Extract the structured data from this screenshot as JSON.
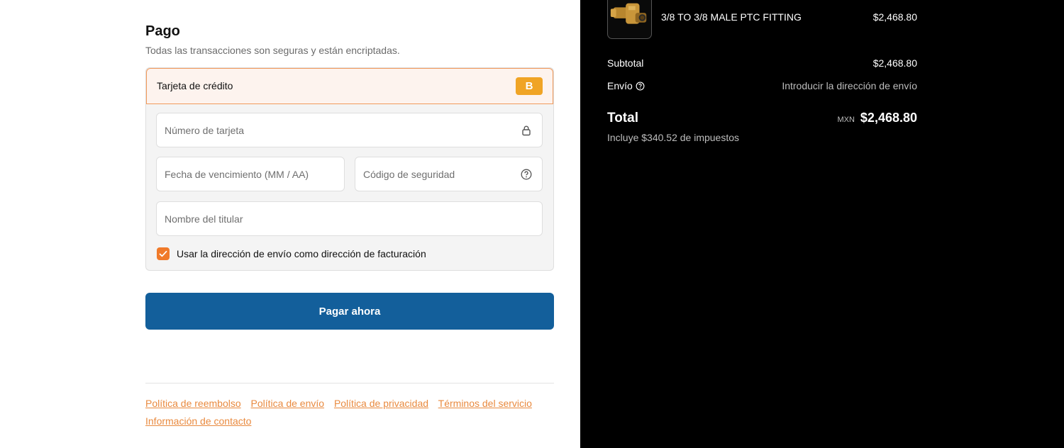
{
  "payment": {
    "title": "Pago",
    "subtitle": "Todas las transacciones son seguras y están encriptadas.",
    "method_label": "Tarjeta de crédito",
    "method_badge": "B",
    "card_number_placeholder": "Número de tarjeta",
    "expiry_placeholder": "Fecha de vencimiento (MM / AA)",
    "cvv_placeholder": "Código de seguridad",
    "name_placeholder": "Nombre del titular",
    "billing_same_label": "Usar la dirección de envío como dirección de facturación",
    "billing_same_checked": true,
    "pay_button": "Pagar ahora"
  },
  "footer": {
    "links": [
      "Política de reembolso",
      "Política de envío",
      "Política de privacidad",
      "Términos del servicio",
      "Información de contacto"
    ]
  },
  "summary": {
    "product_name": "3/8 TO 3/8 MALE PTC FITTING",
    "product_price": "$2,468.80",
    "subtotal_label": "Subtotal",
    "subtotal_value": "$2,468.80",
    "shipping_label": "Envío",
    "shipping_value": "Introducir la dirección de envío",
    "total_label": "Total",
    "currency": "MXN",
    "total_value": "$2,468.80",
    "tax_note": "Incluye $340.52 de impuestos"
  },
  "colors": {
    "accent": "#f07a2a",
    "pay_button": "#135f9b",
    "bitcoin": "#f0a425"
  },
  "icons": [
    "lock-icon",
    "question-icon",
    "check-icon",
    "bitcoin-icon"
  ]
}
